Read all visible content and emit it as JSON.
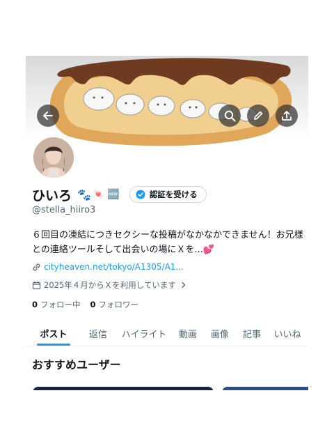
{
  "profile": {
    "name": "ひいろ",
    "handle": "@stella_hiiro3",
    "verify_button": "認証を受ける",
    "bio": "６回目の凍結につきセクシーな投稿がなかなかできません！お兄様との連絡ツールそして出会いの場にＸを...💕",
    "link": "cityheaven.net/tokyo/A1305/A1...",
    "joined": "2025年４月からＸを利用しています",
    "following_count": "0",
    "following_label": "フォロー中",
    "followers_count": "0",
    "followers_label": "フォロワー",
    "name_emojis": [
      "🐾",
      "🍬",
      "🆕"
    ]
  },
  "tabs": [
    {
      "label": "ポスト",
      "active": true
    },
    {
      "label": "返信"
    },
    {
      "label": "ハイライト"
    },
    {
      "label": "動画"
    },
    {
      "label": "画像"
    },
    {
      "label": "記事"
    },
    {
      "label": "いいね"
    }
  ],
  "section": {
    "title": "おすすめユーザー"
  },
  "icons": [
    "back-arrow-icon",
    "search-icon",
    "edit-pencil-icon",
    "share-upload-icon",
    "verified-check-icon",
    "link-icon",
    "calendar-icon",
    "chevron-right-icon"
  ],
  "colors": {
    "accent": "#1d9bf0",
    "text": "#0f1419",
    "muted": "#536471"
  }
}
